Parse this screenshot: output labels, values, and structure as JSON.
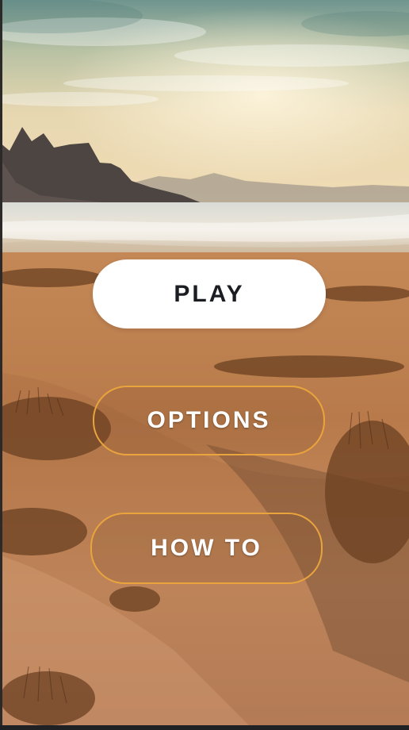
{
  "menu": {
    "play_label": "PLAY",
    "options_label": "OPTIONS",
    "howto_label": "HOW TO"
  },
  "colors": {
    "play_bg": "#ffffff",
    "play_text": "#1b1d22",
    "outline_border": "#e9a43d",
    "outline_text": "#ffffff",
    "sky_top": "#7fa39a",
    "sand": "#b67848"
  },
  "background": {
    "scene": "desert-coastline-background"
  }
}
